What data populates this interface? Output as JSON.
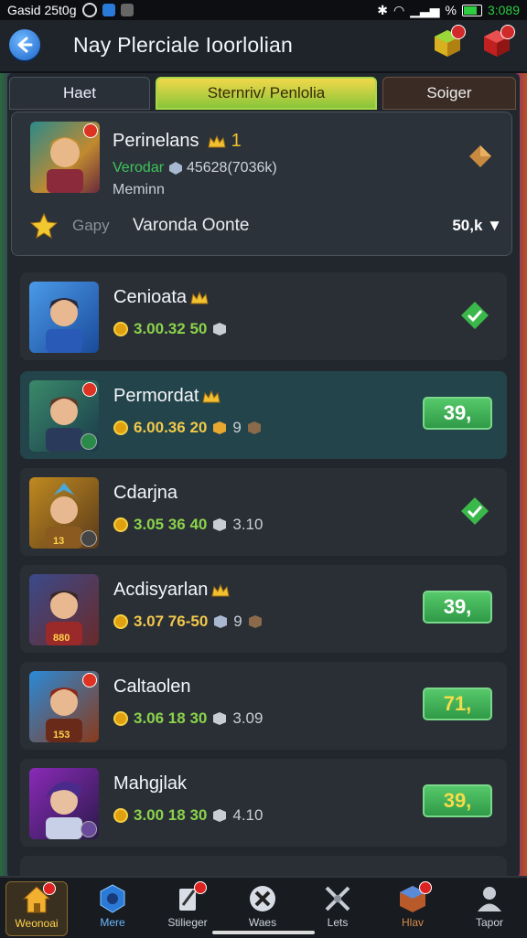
{
  "status_bar": {
    "carrier": "Gasid 25t0g",
    "battery_pct": "%",
    "time": "3:089"
  },
  "header": {
    "title": "Nay Plerciale Ioorlolian"
  },
  "tabs": [
    {
      "label": "Haet"
    },
    {
      "label": "Sternriv/ Penlolia"
    },
    {
      "label": "Soiger"
    }
  ],
  "featured": {
    "name": "Perinelans",
    "rank": "1",
    "sub_label": "Verodar",
    "sub_value": "45628(7036k)",
    "sub2": "Meminn",
    "gapy": "Gapy",
    "vo_label": "Varonda Oonte",
    "value": "50,k"
  },
  "rows": [
    {
      "name": "Cenioata",
      "coins": "3.00.32 50",
      "extra": "",
      "status": "check"
    },
    {
      "name": "Permordat",
      "coins": "6.00.36 20",
      "extra": "9",
      "status": "39,"
    },
    {
      "name": "Cdarjna",
      "coins": "3.05 36 40",
      "extra": "3.10",
      "status": "check",
      "level": "13"
    },
    {
      "name": "Acdisyarlan",
      "coins": "3.07 76-50",
      "extra": "9",
      "status": "39,",
      "level": "880"
    },
    {
      "name": "Caltaolen",
      "coins": "3.06 18 30",
      "extra": "3.09",
      "status": "71,",
      "level": "153"
    },
    {
      "name": "Mahgjlak",
      "coins": "3.00 18 30",
      "extra": "4.10",
      "status": "39,"
    }
  ],
  "nav": [
    {
      "label": "Weonoai",
      "icon": "home-icon"
    },
    {
      "label": "Mere",
      "icon": "shield-icon"
    },
    {
      "label": "Stilieger",
      "icon": "quill-icon"
    },
    {
      "label": "Waes",
      "icon": "tools-icon"
    },
    {
      "label": "Lets",
      "icon": "swords-icon"
    },
    {
      "label": "Hlav",
      "icon": "chest-icon"
    },
    {
      "label": "Tapor",
      "icon": "profile-icon"
    }
  ],
  "colors": {
    "accent_green": "#3cc65a",
    "tab_active": "#f2d84a",
    "badge_red": "#d02a2a"
  }
}
